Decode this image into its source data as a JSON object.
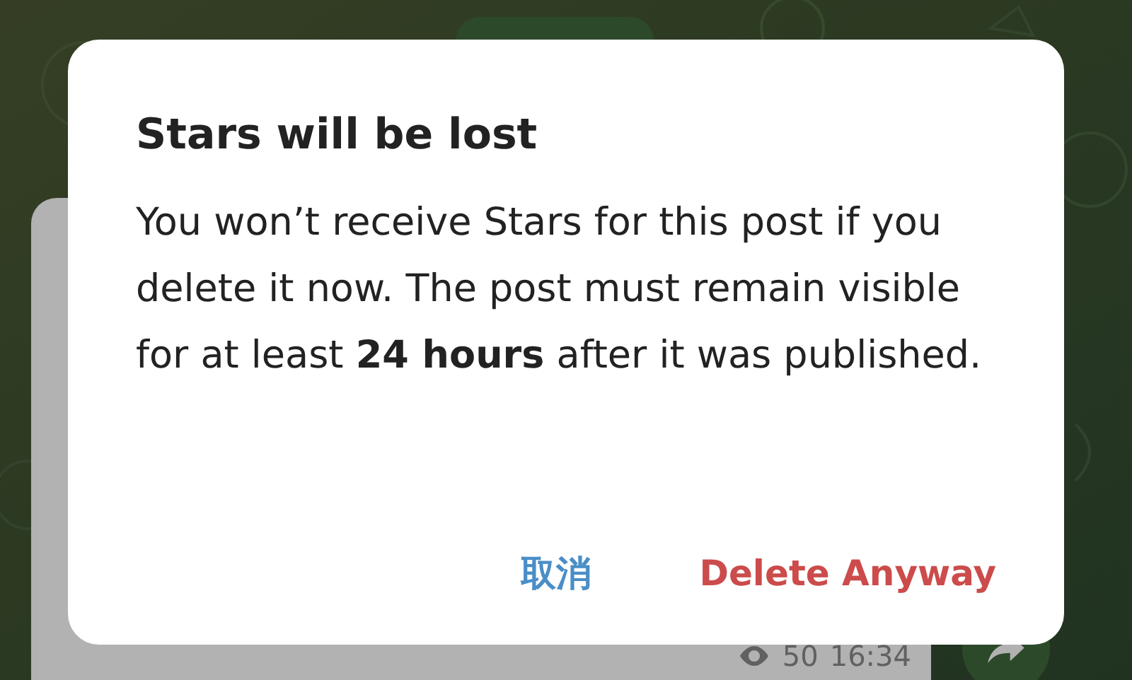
{
  "chat": {
    "post": {
      "views": "50",
      "time": "16:34"
    }
  },
  "dialog": {
    "title": "Stars will be lost",
    "message": "You won’t receive Stars for this post if you delete it now. The post must remain visible for at least **24 hours** after it was published.",
    "buttons": [
      {
        "label": "取消",
        "kind": "cancel"
      },
      {
        "label": "Delete Anyway",
        "kind": "destructive"
      }
    ]
  }
}
